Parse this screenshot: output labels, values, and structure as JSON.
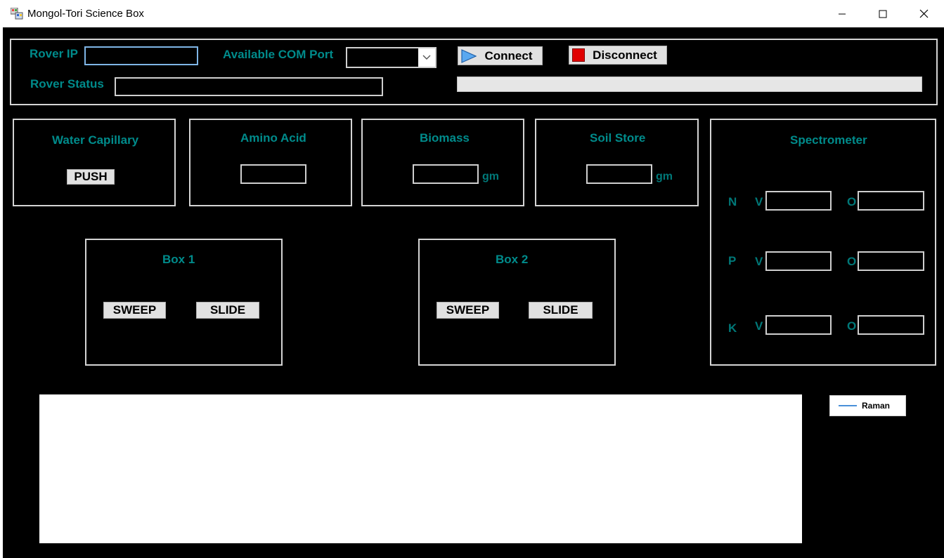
{
  "window": {
    "title": "Mongol-Tori Science Box",
    "controls": [
      "minimize-icon",
      "maximize-icon",
      "close-icon"
    ]
  },
  "connection": {
    "rover_ip_label": "Rover IP",
    "rover_ip_value": "",
    "com_port_label": "Available COM Port",
    "com_port_value": "",
    "rover_status_label": "Rover Status",
    "rover_status_value": "",
    "connect_label": "Connect",
    "connect_icon": "play-arrow-icon",
    "disconnect_label": "Disconnect",
    "disconnect_icon": "stop-square-icon",
    "progress_value": 0
  },
  "water_capillary": {
    "title": "Water Capillary",
    "push_label": "PUSH"
  },
  "amino_acid": {
    "title": "Amino Acid",
    "value": ""
  },
  "biomass": {
    "title": "Biomass",
    "value": "",
    "unit": "gm"
  },
  "soil_store": {
    "title": "Soil Store",
    "value": "",
    "unit": "gm"
  },
  "spectrometer": {
    "title": "Spectrometer",
    "rows": [
      {
        "name": "N",
        "v_label": "V",
        "o_label": "O",
        "v_value": "",
        "o_value": ""
      },
      {
        "name": "P",
        "v_label": "V",
        "o_label": "O",
        "v_value": "",
        "o_value": ""
      },
      {
        "name": "K",
        "v_label": "V",
        "o_label": "O",
        "v_value": "",
        "o_value": ""
      }
    ]
  },
  "box1": {
    "title": "Box 1",
    "sweep_label": "SWEEP",
    "slide_label": "SLIDE"
  },
  "box2": {
    "title": "Box 2",
    "sweep_label": "SWEEP",
    "slide_label": "SLIDE"
  },
  "chart": {
    "legend": [
      {
        "name": "Raman",
        "color": "#4a90d9"
      }
    ]
  },
  "colors": {
    "background": "#000000",
    "label_teal": "#008b8b",
    "frame_border": "#d4d4d4",
    "button_face": "#e1e1e1",
    "disconnect_red": "#e00000",
    "connect_blue": "#3a8fe0"
  }
}
